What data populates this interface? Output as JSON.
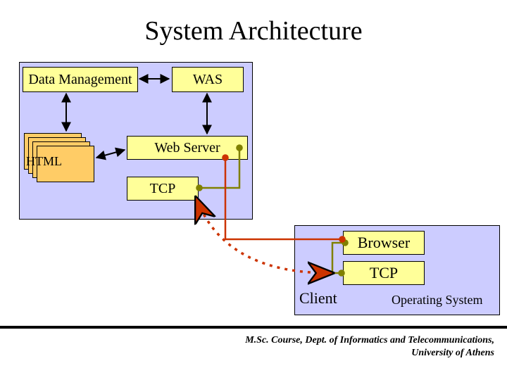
{
  "title": "System Architecture",
  "server_panel": {
    "data_mgmt": "Data Management",
    "was": "WAS",
    "html_stack_label": "HTML",
    "web_server": "Web Server",
    "tcp": "TCP"
  },
  "client_panel": {
    "browser": "Browser",
    "tcp": "TCP",
    "client_label": "Client",
    "os_label": "Operating System"
  },
  "footer": {
    "line1": "M.Sc. Course, Dept. of Informatics and Telecommunications,",
    "line2": "University of Athens"
  },
  "colors": {
    "panel_bg": "#ccccff",
    "box_bg": "#ffff99",
    "stack_bg": "#ffcc66",
    "arrow_black": "#000000",
    "conn_green": "#808000",
    "conn_red": "#cc3300"
  }
}
